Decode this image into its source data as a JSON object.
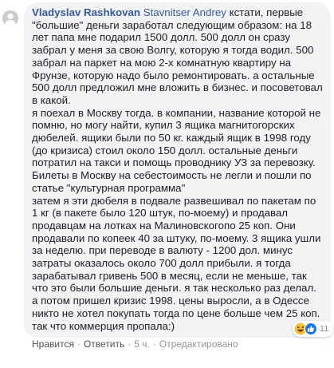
{
  "comment": {
    "author": "Vladyslav Rashkovan",
    "mention": "Stavnitser Andrey",
    "intro": " кстати, первые \"большие\" деньги заработал следующим образом: на 18 лет папа мне подарил 1500 долл. 500 долл он сразу забрал у меня за свою Волгу, которую я тогда водил. 500 забрал на паркет на мою 2-х комнатную квартиру на Фрунзе, которую надо было ремонтировать. а остальные 500 долл предложил мне вложить в бизнес. и посоветовал в какой.",
    "paragraph2": "я поехал в Москву тогда. в компании, название которой не помню, но могу найти, купил 3 ящика магнитогорских дюбелей. ящики были по 50 кг. каждый ящик в 1998 году (до кризиса) стоил около 150 долл. остальные деньги потратил на такси и помощь проводнику УЗ за перевозку. Билеты в Москву на себестоимость не легли и пошли по статье \"культурная программа\"",
    "paragraph3": "затем я эти дюбеля в подвале развешивал по пакетам по 1 кг (в пакете было 120 штук, по-моему) и продавал продавцам на лотках на Малиновскогопо 25 коп. Они продавали по копеек 40 за штуку, по-моему. 3 ящика ушли за неделю. при переводе в валюту - 1200 дол. минус затраты оказалось около 700 долл прибыли. я тогда зарабатывал гривень 500 в месяц, если не меньше, так что это были большие деньги. я так несколько раз делал. а потом пришел кризис 1998. цены выросли, а в Одессе никто не хотел покупать тогда по цене больше чем 25 коп. так что коммерция пропала:)"
  },
  "reactions": {
    "count": "11",
    "icons": [
      "haha-icon",
      "like-icon"
    ]
  },
  "actions": {
    "like": "Нравится",
    "reply": "Ответить",
    "time": "5 ч.",
    "edited": "Отредактировано",
    "separator": "·"
  },
  "colors": {
    "link": "#385898",
    "bubble": "#f2f3f5",
    "text": "#1c1e21",
    "muted": "#90949c"
  }
}
